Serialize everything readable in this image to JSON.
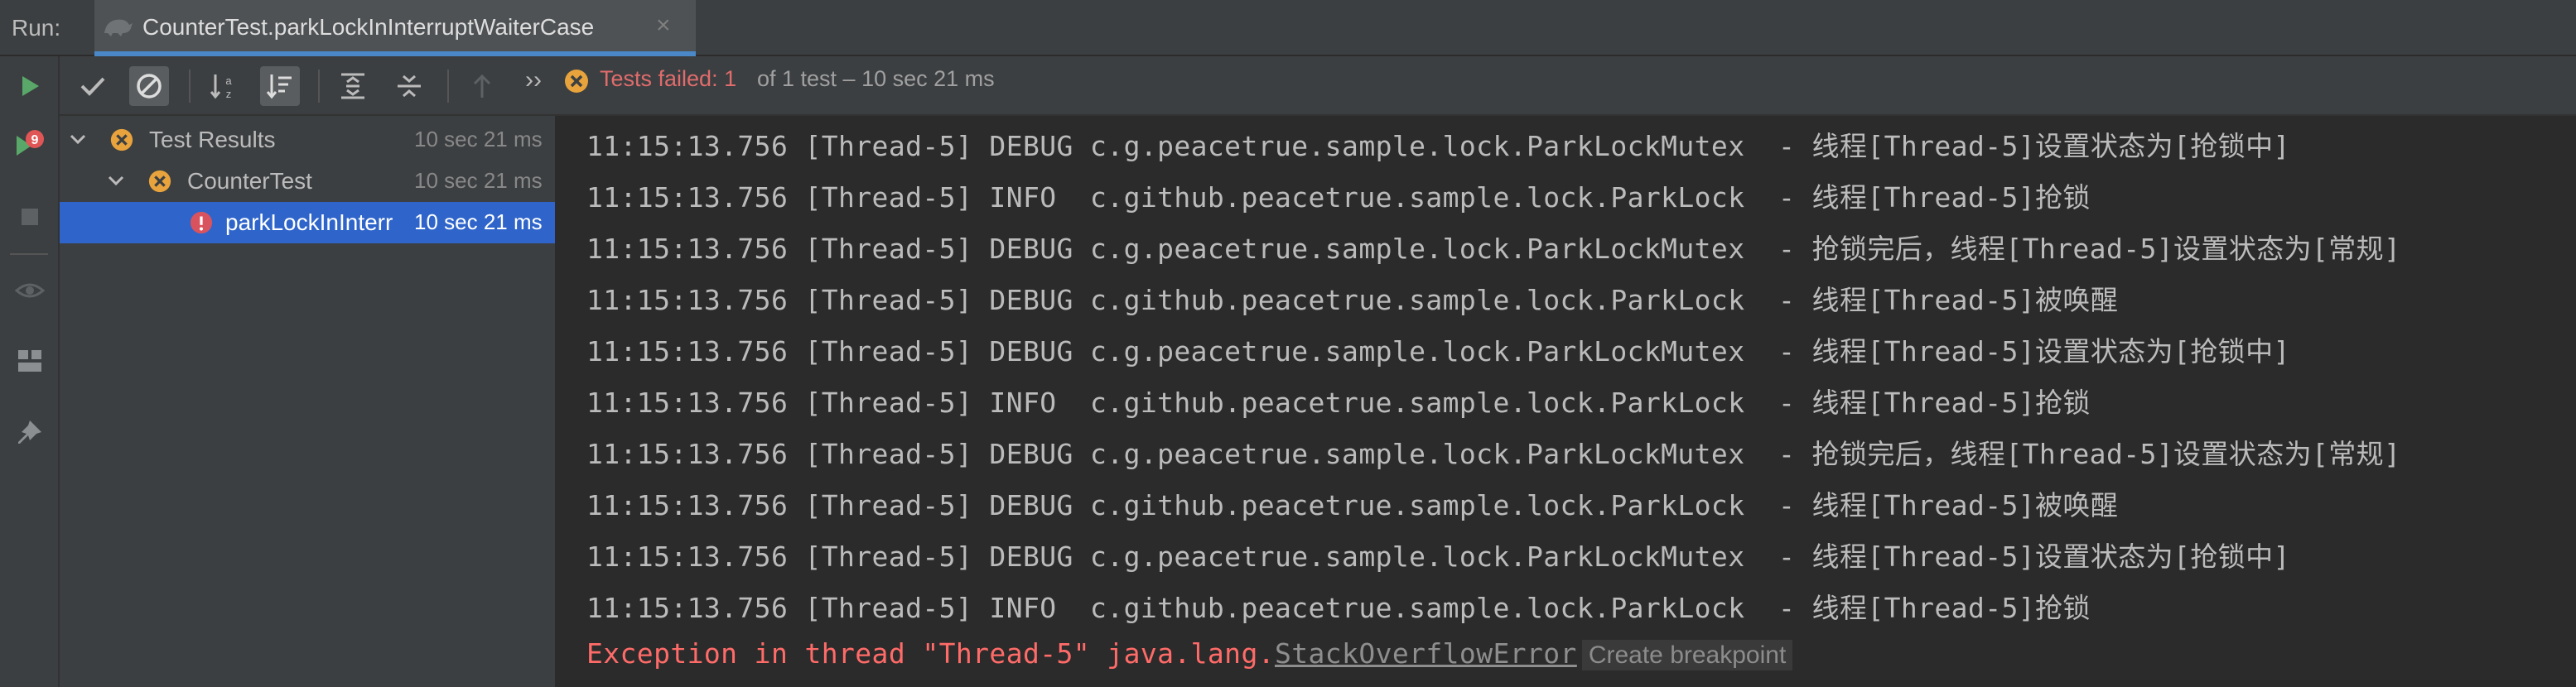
{
  "run": {
    "label": "Run:",
    "tab_title": "CounterTest.parkLockInInterruptWaiterCase",
    "close_glyph": "×"
  },
  "left_toolbar": {
    "icons": [
      "run-icon",
      "rerun-failed-icon",
      "stop-icon",
      "eye-icon",
      "layout-icon",
      "pin-icon"
    ]
  },
  "test_toolbar": {
    "status_failed": "Tests failed: 1",
    "status_rest": " of 1 test – 10 sec 21 ms",
    "more_glyph": "››"
  },
  "tree": {
    "rows": [
      {
        "label": "Test Results",
        "time": "10 sec 21 ms"
      },
      {
        "label": "CounterTest",
        "time": "10 sec 21 ms"
      },
      {
        "label": "parkLockInInterr",
        "time": "10 sec 21 ms"
      }
    ]
  },
  "console": {
    "lines": [
      "11:15:13.756 [Thread-5] DEBUG c.g.peacetrue.sample.lock.ParkLockMutex  - 线程[Thread-5]设置状态为[抢锁中]",
      "11:15:13.756 [Thread-5] INFO  c.github.peacetrue.sample.lock.ParkLock  - 线程[Thread-5]抢锁",
      "11:15:13.756 [Thread-5] DEBUG c.g.peacetrue.sample.lock.ParkLockMutex  - 抢锁完后，线程[Thread-5]设置状态为[常规]",
      "11:15:13.756 [Thread-5] DEBUG c.github.peacetrue.sample.lock.ParkLock  - 线程[Thread-5]被唤醒",
      "11:15:13.756 [Thread-5] DEBUG c.g.peacetrue.sample.lock.ParkLockMutex  - 线程[Thread-5]设置状态为[抢锁中]",
      "11:15:13.756 [Thread-5] INFO  c.github.peacetrue.sample.lock.ParkLock  - 线程[Thread-5]抢锁",
      "11:15:13.756 [Thread-5] DEBUG c.g.peacetrue.sample.lock.ParkLockMutex  - 抢锁完后，线程[Thread-5]设置状态为[常规]",
      "11:15:13.756 [Thread-5] DEBUG c.github.peacetrue.sample.lock.ParkLock  - 线程[Thread-5]被唤醒",
      "11:15:13.756 [Thread-5] DEBUG c.g.peacetrue.sample.lock.ParkLockMutex  - 线程[Thread-5]设置状态为[抢锁中]",
      "11:15:13.756 [Thread-5] INFO  c.github.peacetrue.sample.lock.ParkLock  - 线程[Thread-5]抢锁"
    ],
    "exception_prefix": "Exception in thread \"Thread-5\" java.lang.",
    "exception_link": "StackOverflowError",
    "create_breakpoint": "Create breakpoint"
  },
  "colors": {
    "failed": "#E06C6C",
    "selected": "#2F65CA",
    "error_text": "#FF6B68",
    "run_green": "#59A869"
  }
}
